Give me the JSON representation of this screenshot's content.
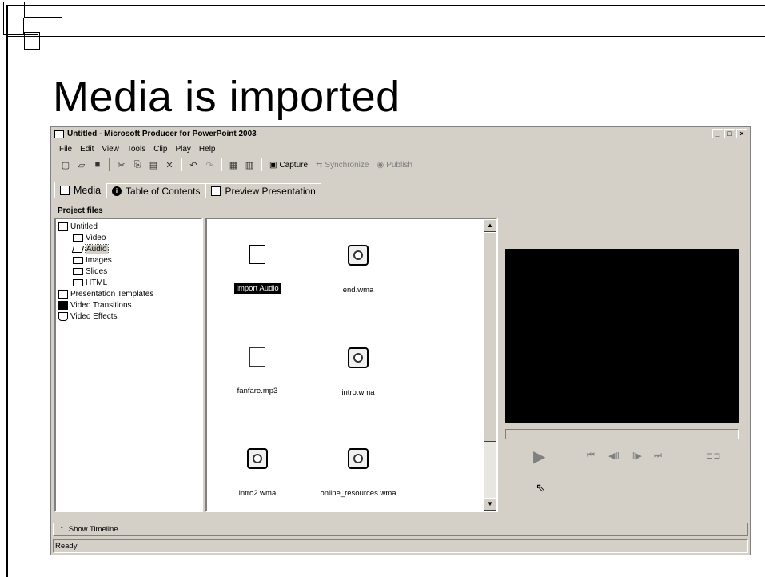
{
  "slide": {
    "title": "Media is imported"
  },
  "window": {
    "title": "Untitled - Microsoft Producer for PowerPoint 2003",
    "controls": {
      "minimize": "_",
      "maximize": "□",
      "close": "×"
    }
  },
  "menu": [
    "File",
    "Edit",
    "View",
    "Tools",
    "Clip",
    "Play",
    "Help"
  ],
  "toolbar": {
    "capture": "Capture",
    "synchronize": "Synchronize",
    "publish": "Publish"
  },
  "tabs": [
    {
      "label": "Media",
      "icon": "media-icon"
    },
    {
      "label": "Table of Contents",
      "icon": "info-icon"
    },
    {
      "label": "Preview Presentation",
      "icon": "preview-icon"
    }
  ],
  "project": {
    "label": "Project files",
    "tree": [
      {
        "label": "Untitled",
        "icon": "project-icon"
      },
      {
        "label": "Video",
        "icon": "folder-icon"
      },
      {
        "label": "Audio",
        "icon": "open-folder-icon",
        "selected": true
      },
      {
        "label": "Images",
        "icon": "folder-icon"
      },
      {
        "label": "Slides",
        "icon": "folder-icon"
      },
      {
        "label": "HTML",
        "icon": "folder-icon"
      },
      {
        "label": "Presentation Templates",
        "icon": "templates-icon"
      },
      {
        "label": "Video Transitions",
        "icon": "transitions-icon"
      },
      {
        "label": "Video Effects",
        "icon": "effects-icon"
      }
    ]
  },
  "media_items": [
    {
      "label": "Import Audio",
      "icon": "import-document-icon",
      "selected": true
    },
    {
      "label": "end.wma",
      "icon": "audio-file-icon"
    },
    {
      "label": "fanfare.mp3",
      "icon": "mp3-file-icon"
    },
    {
      "label": "intro.wma",
      "icon": "audio-file-icon"
    },
    {
      "label": "intro2.wma",
      "icon": "audio-file-icon"
    },
    {
      "label": "online_resources.wma",
      "icon": "audio-file-icon"
    }
  ],
  "timeline": {
    "label": "Show Timeline"
  },
  "status": {
    "text": "Ready"
  }
}
